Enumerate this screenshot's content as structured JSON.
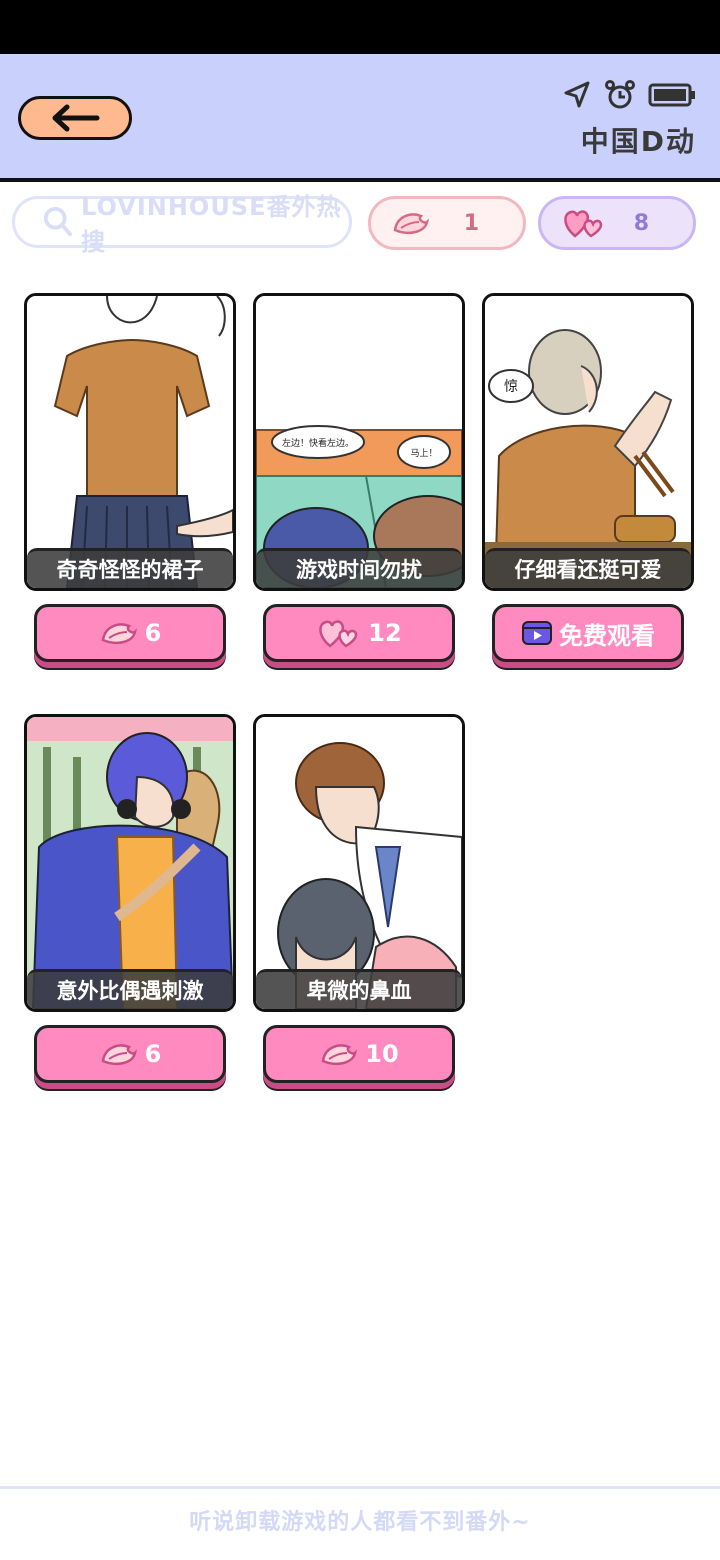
{
  "header": {
    "status_label": "中国D动"
  },
  "search": {
    "label": "LOVINHOUSE番外热搜"
  },
  "stats": {
    "petals": "1",
    "hearts": "8"
  },
  "cards": [
    {
      "title": "奇奇怪怪的裙子",
      "price": "6",
      "price_icon": "petal-icon"
    },
    {
      "title": "游戏时间勿扰",
      "price": "12",
      "price_icon": "hearts-icon",
      "bubble1": "左边！快看左边。",
      "bubble2": "马上！"
    },
    {
      "title": "仔细看还挺可爱",
      "price": "免费观看",
      "price_icon": "video-icon",
      "exclaim": "惊"
    },
    {
      "title": "意外比偶遇刺激",
      "price": "6",
      "price_icon": "petal-icon"
    },
    {
      "title": "卑微的鼻血",
      "price": "10",
      "price_icon": "petal-icon"
    }
  ],
  "footer": {
    "text": "听说卸载游戏的人都看不到番外~"
  },
  "colors": {
    "header_bg": "#c9d0fb",
    "button_pink": "#ff8ac0",
    "back_button": "#ffb98f"
  }
}
